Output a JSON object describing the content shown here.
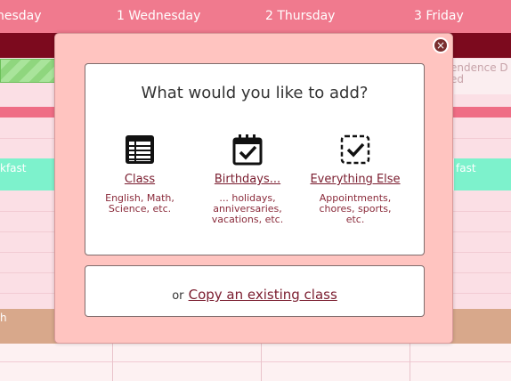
{
  "calendar": {
    "days": [
      "nesday",
      "1 Wednesday",
      "2 Thursday",
      "3 Friday"
    ],
    "right_event": "endence D\ned",
    "breakfast_left": "kfast",
    "breakfast_right": "fast",
    "lunch_left": "h"
  },
  "modal": {
    "close_symbol": "×",
    "question": "What would you like to add?",
    "options": [
      {
        "label": "Class",
        "desc": "English, Math,\nScience, etc.",
        "icon": "table-icon"
      },
      {
        "label": "Birthdays...",
        "desc": "... holidays,\nanniversaries,\nvacations, etc.",
        "icon": "calendar-check-icon"
      },
      {
        "label": "Everything Else",
        "desc": "Appointments,\nchores, sports,\netc.",
        "icon": "dashed-checkbox-icon"
      }
    ],
    "copy_prefix": "or",
    "copy_link": "Copy an existing class"
  },
  "colors": {
    "header": "#f07a8e",
    "maroon": "#7c0a1e",
    "modal_bg": "#ffc4c0",
    "link": "#7a1c2e",
    "breakfast": "#7df2cc",
    "lunch": "#d8a88b"
  }
}
